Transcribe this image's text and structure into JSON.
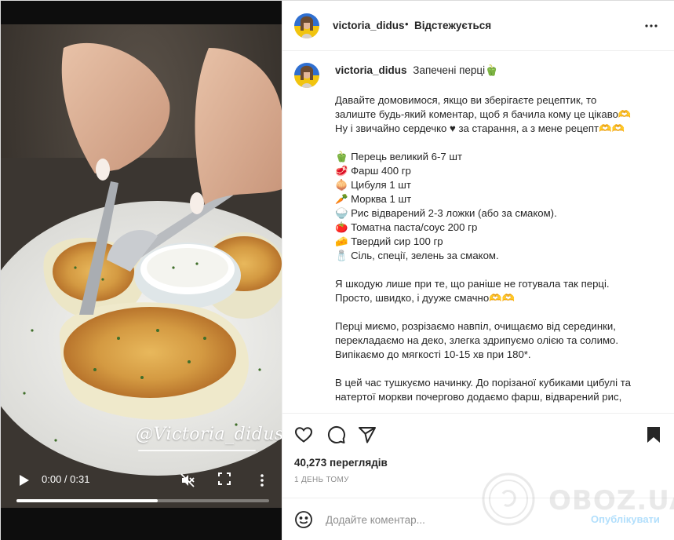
{
  "video": {
    "watermark": "@Victoria_didus",
    "time": "0:00 / 0:31",
    "progress_fraction": 0.56,
    "icons": {
      "play": "play-icon",
      "mute": "volume-muted-icon",
      "fullscreen": "fullscreen-icon",
      "more": "more-vertical-icon"
    }
  },
  "header": {
    "username": "victoria_didus",
    "separator": "•",
    "follow_label": "Відстежується",
    "more_icon": "more-horizontal-icon"
  },
  "caption": {
    "username": "victoria_didus",
    "title": "Запечені перці🫑",
    "paragraphs": [
      [
        "Давайте домовимося, якщо ви зберігаєте рецептик, то",
        "залиште будь-який коментар, щоб я бачила кому це цікаво🫶",
        "Ну і звичайно сердечко ♥ за старання, а з мене рецепт🫶🫶"
      ],
      [
        "🫑 Перець великий 6-7 шт",
        "🥩 Фарш 400 гр",
        "🧅 Цибуля 1 шт",
        "🥕 Морква 1 шт",
        "🍚 Рис відварений 2-3 ложки (або за смаком).",
        "🍅 Томатна паста/соус 200 гр",
        "🧀 Твердий сир 100 гр",
        "🧂 Сіль, спеції, зелень за смаком."
      ],
      [
        "Я шкодую лише при те, що раніше не готувала так перці.",
        "Просто, швидко, і дууже смачно🫶🫶"
      ],
      [
        "Перці миємо, розрізаємо навпіл, очищаємо від серединки,",
        "перекладаємо на деко, злегка здрипуємо олією та солимо.",
        "Випікаємо до мягкості 10-15 хв при 180*."
      ],
      [
        "В цей час тушкуємо начинку. До порізаної кубиками цибулі та",
        "натертої моркви почергово додаємо фарш, відварений рис,"
      ]
    ]
  },
  "actions": {
    "like_icon": "heart-icon",
    "comment_icon": "comment-icon",
    "share_icon": "share-icon",
    "save_icon": "bookmark-icon"
  },
  "stats": {
    "views": "40,273 переглядів",
    "timestamp": "1 ДЕНЬ ТОМУ"
  },
  "comment": {
    "emoji_icon": "emoji-icon",
    "placeholder": "Додайте коментар...",
    "publish_label": "Опублікувати"
  },
  "watermark_site": "OBOZ.UA",
  "colors": {
    "publish_disabled": "#b2dffc",
    "text": "#262626",
    "muted": "#8e8e8e",
    "border": "#efefef"
  }
}
